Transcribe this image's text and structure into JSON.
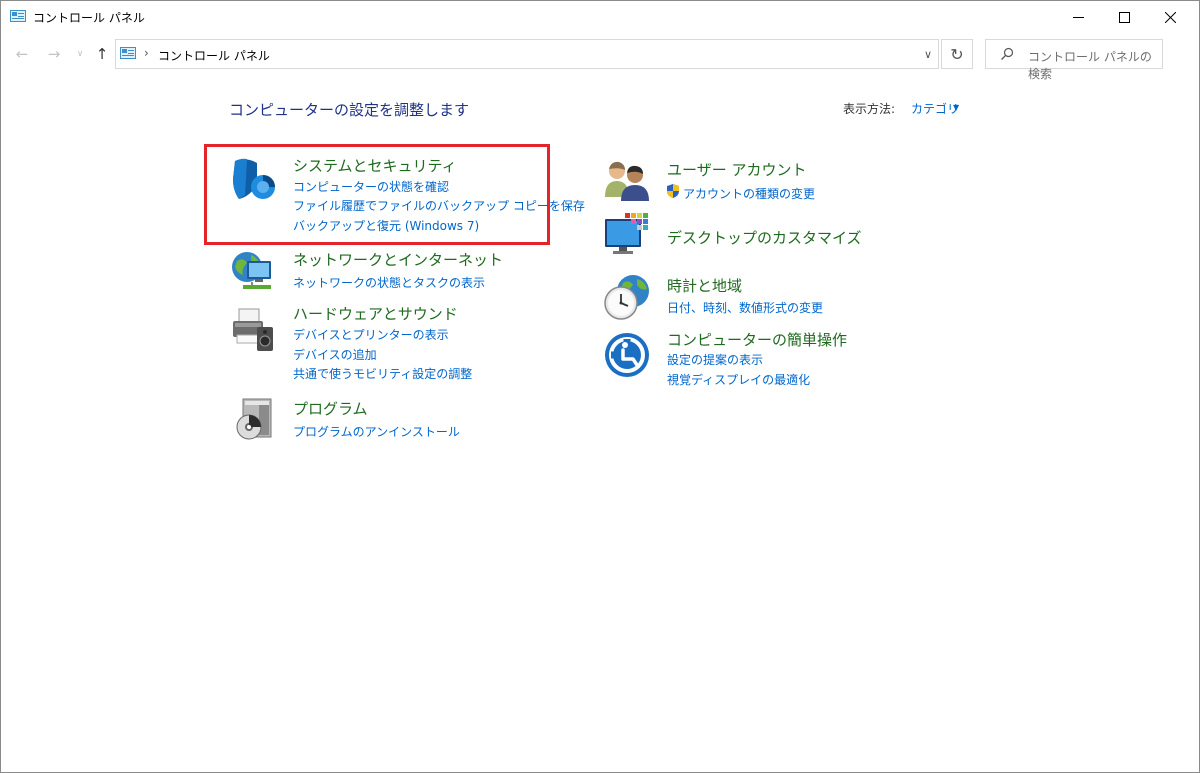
{
  "window": {
    "title": "コントロール パネル"
  },
  "address_bar": {
    "breadcrumb": "コントロール パネル"
  },
  "search": {
    "placeholder": "コントロール パネルの検索"
  },
  "header": {
    "title": "コンピューターの設定を調整します",
    "view_by_label": "表示方法:",
    "view_by_value": "カテゴリ"
  },
  "categories": {
    "system_security": {
      "title": "システムとセキュリティ",
      "links": [
        "コンピューターの状態を確認",
        "ファイル履歴でファイルのバックアップ コピーを保存",
        "バックアップと復元 (Windows 7)"
      ]
    },
    "network": {
      "title": "ネットワークとインターネット",
      "links": [
        "ネットワークの状態とタスクの表示"
      ]
    },
    "hardware": {
      "title": "ハードウェアとサウンド",
      "links": [
        "デバイスとプリンターの表示",
        "デバイスの追加",
        "共通で使うモビリティ設定の調整"
      ]
    },
    "programs": {
      "title": "プログラム",
      "links": [
        "プログラムのアンインストール"
      ]
    },
    "user_accounts": {
      "title": "ユーザー アカウント",
      "links": [
        "アカウントの種類の変更"
      ]
    },
    "desktop": {
      "title": "デスクトップのカスタマイズ",
      "links": []
    },
    "clock_region": {
      "title": "時計と地域",
      "links": [
        "日付、時刻、数値形式の変更"
      ]
    },
    "ease_of_access": {
      "title": "コンピューターの簡単操作",
      "links": [
        "設定の提案の表示",
        "視覚ディスプレイの最適化"
      ]
    }
  },
  "colors": {
    "category_title": "#1e6a1e",
    "link": "#0066cc",
    "page_title": "#1e3287",
    "highlight": "#e4232a"
  }
}
